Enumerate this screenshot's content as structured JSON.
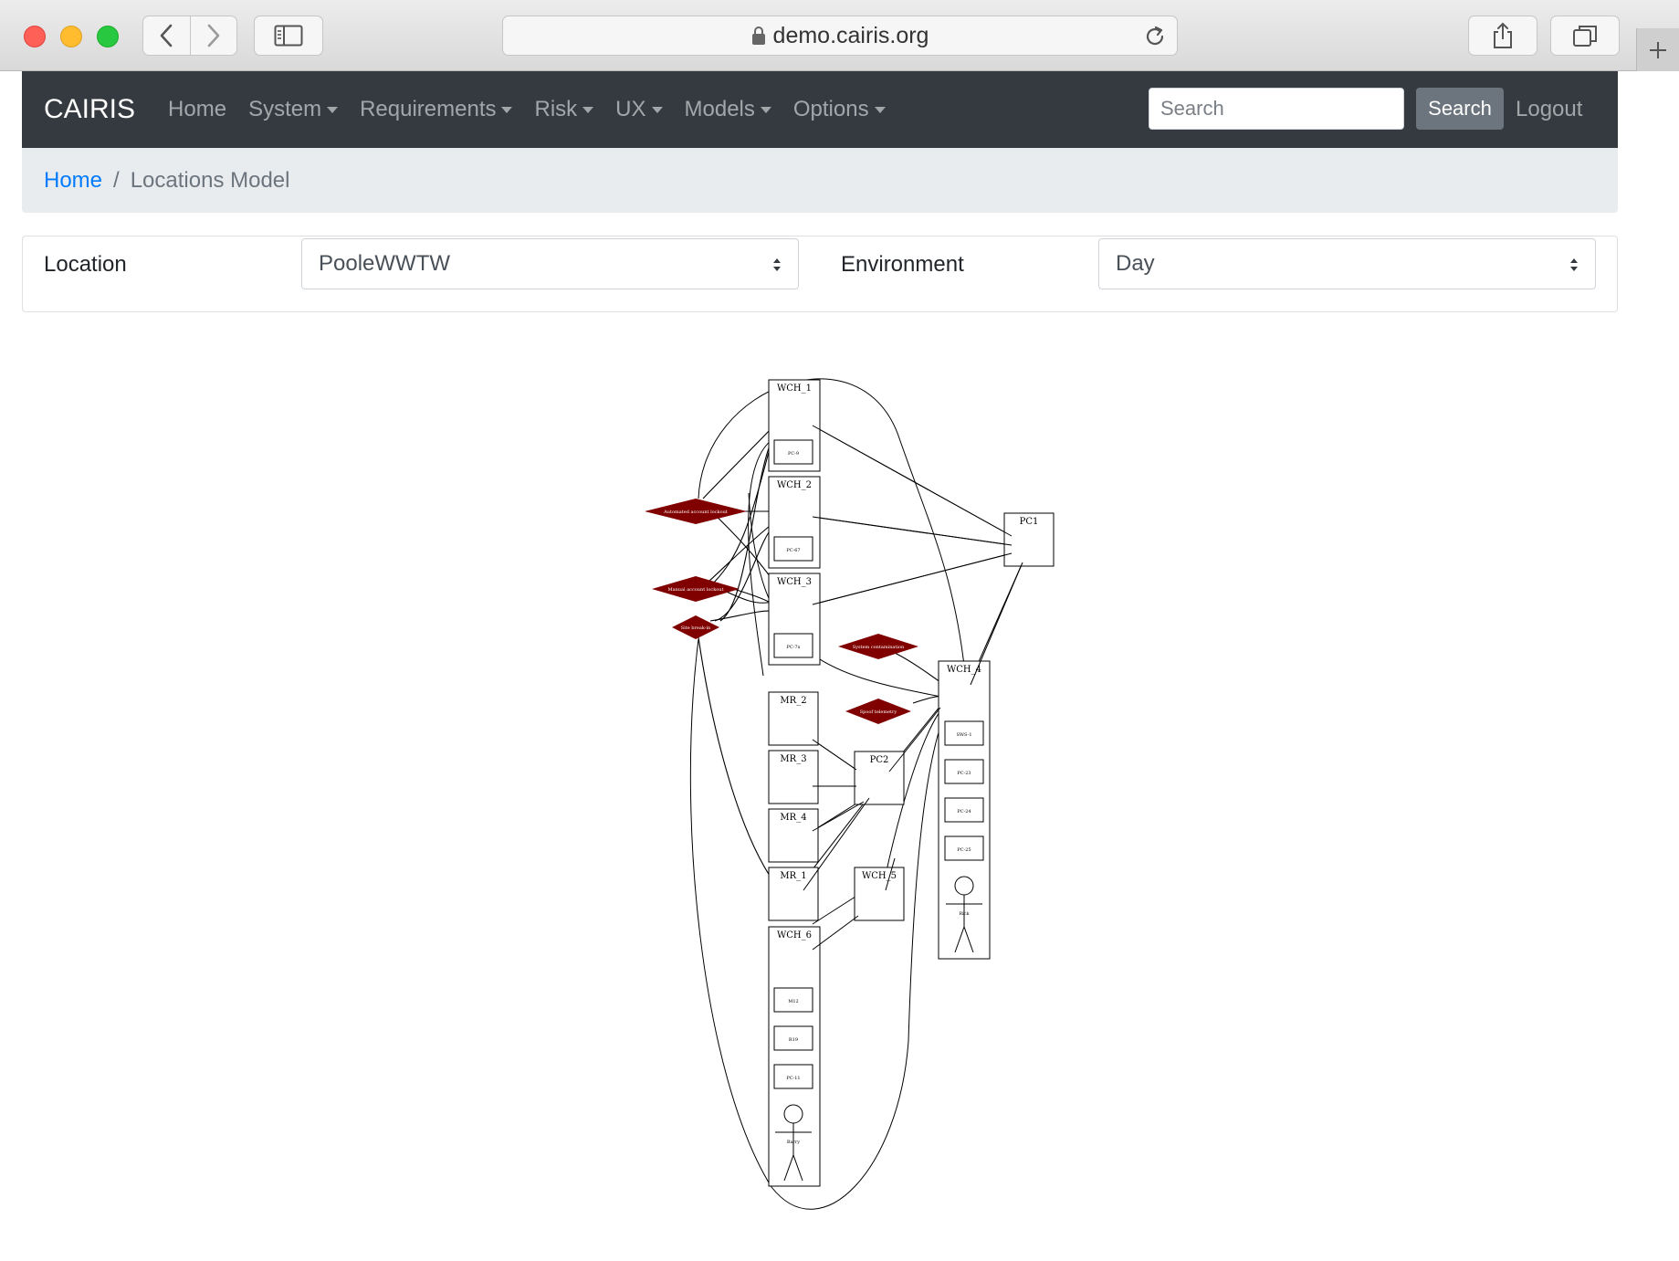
{
  "browser": {
    "url": "demo.cairis.org"
  },
  "navbar": {
    "brand": "CAIRIS",
    "links": [
      {
        "label": "Home"
      },
      {
        "label": "System"
      },
      {
        "label": "Requirements"
      },
      {
        "label": "Risk"
      },
      {
        "label": "UX"
      },
      {
        "label": "Models"
      },
      {
        "label": "Options"
      }
    ],
    "search_placeholder": "Search",
    "search_button": "Search",
    "logout": "Logout"
  },
  "breadcrumb": {
    "home": "Home",
    "current": "Locations Model"
  },
  "filters": {
    "location_label": "Location",
    "location_value": "PooleWWTW",
    "environment_label": "Environment",
    "environment_value": "Day"
  },
  "diagram": {
    "locations": {
      "wch1": {
        "name": "WCH_1",
        "assets": [
          "PC-9"
        ]
      },
      "wch2": {
        "name": "WCH_2",
        "assets": [
          "PC-67"
        ]
      },
      "wch3": {
        "name": "WCH_3",
        "assets": [
          "PC-7x"
        ]
      },
      "pc1": {
        "name": "PC1"
      },
      "wch4": {
        "name": "WCH_4",
        "assets": [
          "SWS-1",
          "PC-23",
          "PC-24",
          "PC-25"
        ],
        "persona": "Rick"
      },
      "mr2": {
        "name": "MR_2"
      },
      "mr3": {
        "name": "MR_3"
      },
      "mr4": {
        "name": "MR_4"
      },
      "mr1": {
        "name": "MR_1"
      },
      "pc2": {
        "name": "PC2"
      },
      "wch5": {
        "name": "WCH_5"
      },
      "wch6": {
        "name": "WCH_6",
        "assets": [
          "M12",
          "R19",
          "PC-11"
        ],
        "persona": "Barry"
      }
    },
    "risks": {
      "r1": "Automated account lockout",
      "r2": "Manual account lockout",
      "r3": "Site break-in",
      "r4": "System contamination",
      "r5": "Spoof telemetry"
    },
    "risk_color": "#800000"
  }
}
